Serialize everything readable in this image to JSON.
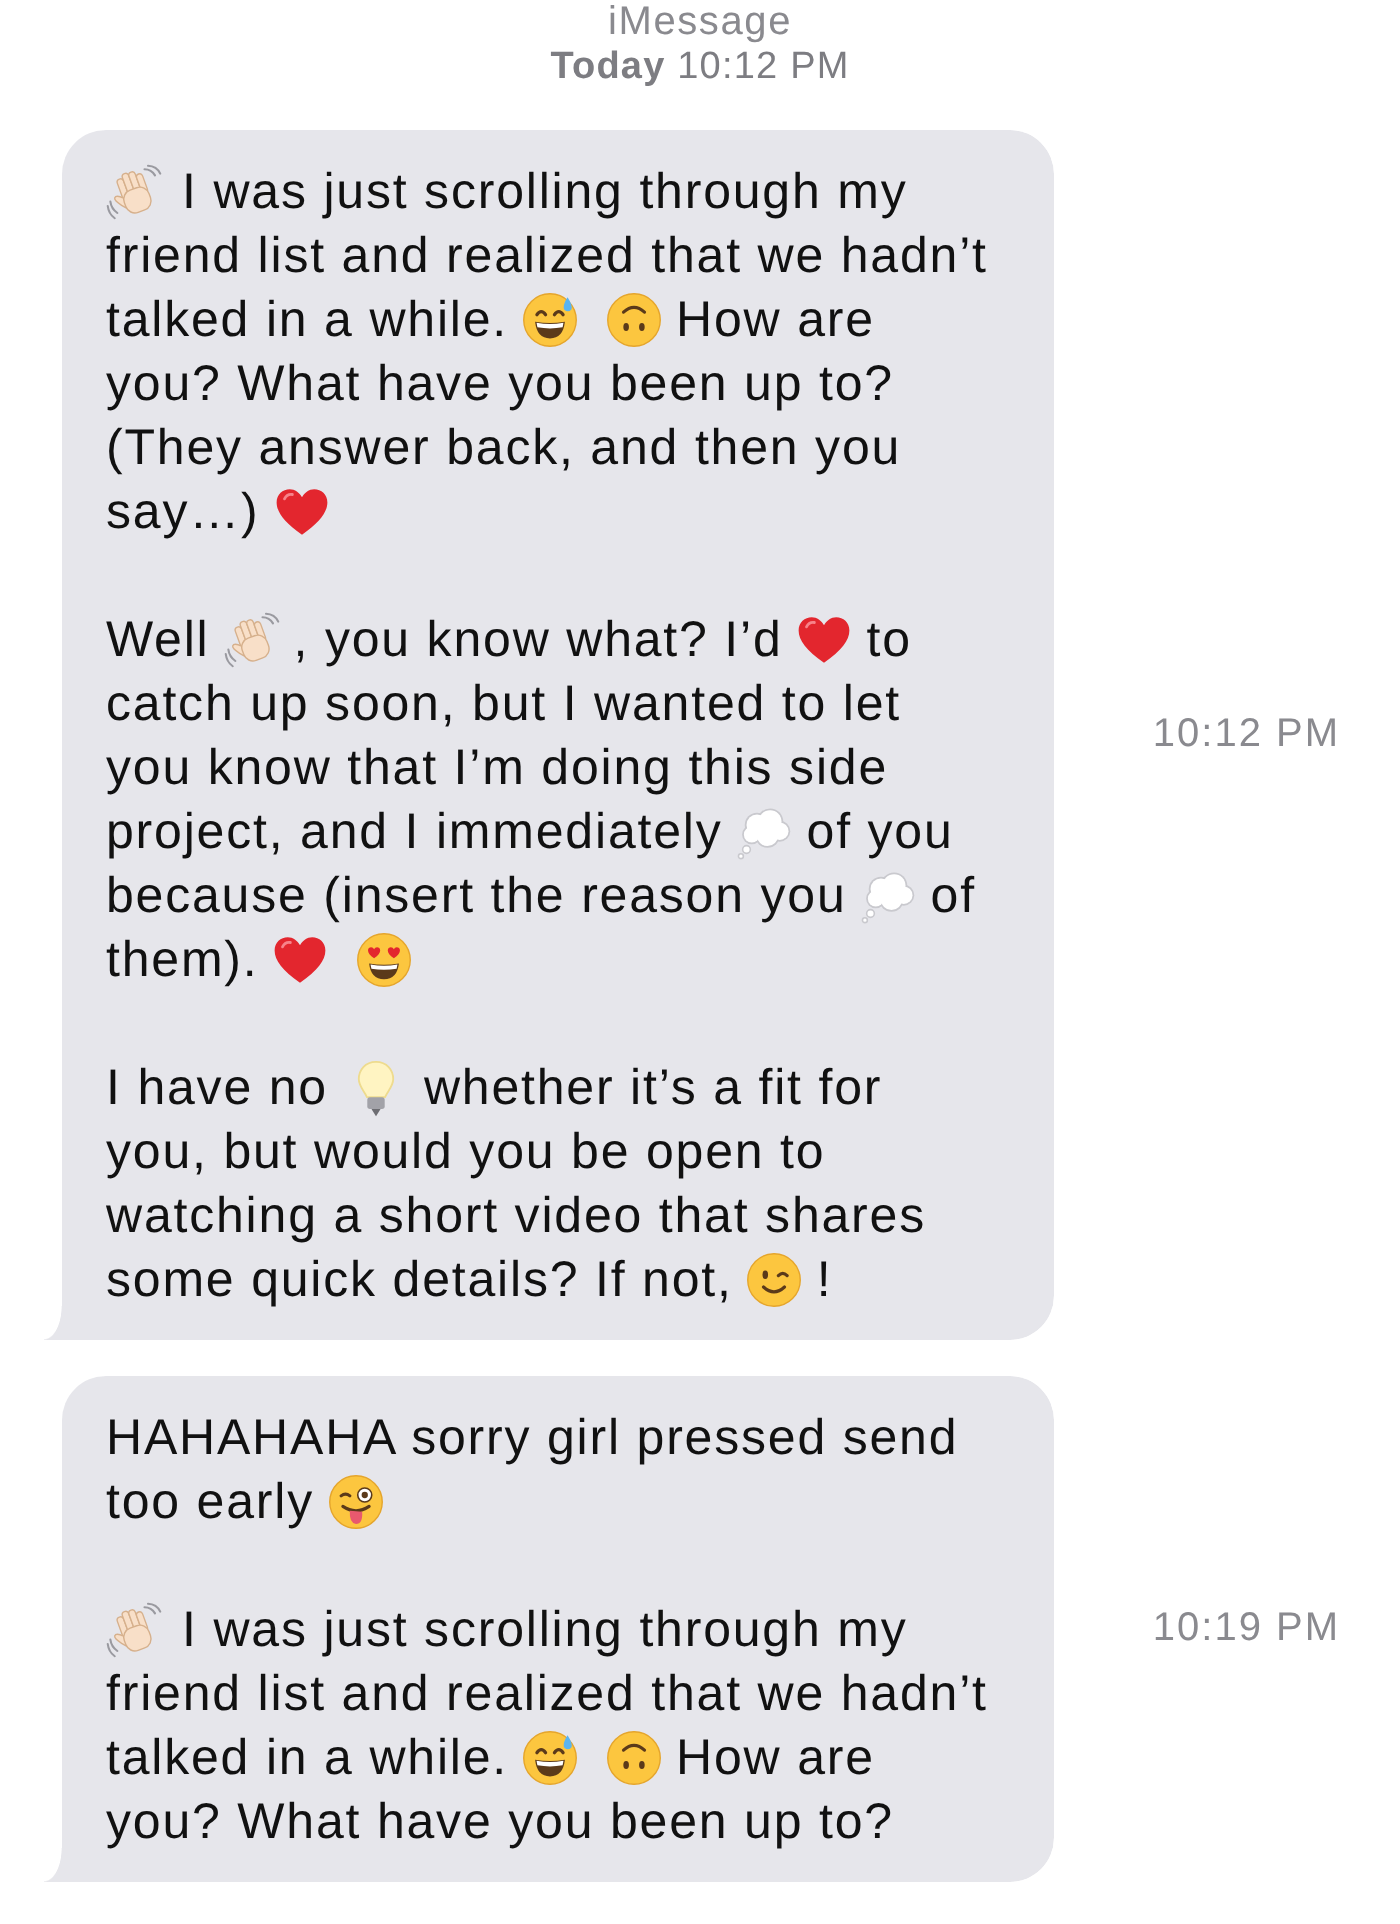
{
  "header": {
    "service": "iMessage",
    "timestamp": "**Today** 10:12 PM"
  },
  "messages": [
    {
      "time": "10:12 PM",
      "paragraphs": [
        [
          [
            {
              "kind": "wave"
            },
            {
              "kind": "text",
              "text": "I was just scrolling through my"
            }
          ],
          [
            {
              "kind": "text",
              "text": "friend list and realized that we hadn’t"
            }
          ],
          [
            {
              "kind": "text",
              "text": "talked in a while."
            },
            {
              "kind": "sweat"
            },
            {
              "kind": "upsidedown"
            },
            {
              "kind": "text",
              "text": "How are"
            }
          ],
          [
            {
              "kind": "text",
              "text": "you? What have you been up to?"
            }
          ],
          [
            {
              "kind": "text",
              "text": "(They answer back, and then you"
            }
          ],
          [
            {
              "kind": "text",
              "text": "say…)"
            },
            {
              "kind": "heart"
            }
          ]
        ],
        [
          [
            {
              "kind": "text",
              "text": "Well"
            },
            {
              "kind": "wave"
            },
            {
              "kind": "text",
              "text": ", you know what? I’d"
            },
            {
              "kind": "heart"
            },
            {
              "kind": "text",
              "text": "to"
            }
          ],
          [
            {
              "kind": "text",
              "text": "catch up soon, but I wanted to let"
            }
          ],
          [
            {
              "kind": "text",
              "text": "you know that I’m doing this side"
            }
          ],
          [
            {
              "kind": "text",
              "text": "project, and I immediately"
            },
            {
              "kind": "thought"
            },
            {
              "kind": "text",
              "text": "of you"
            }
          ],
          [
            {
              "kind": "text",
              "text": "because (insert the reason you"
            },
            {
              "kind": "thought"
            },
            {
              "kind": "text",
              "text": "of"
            }
          ],
          [
            {
              "kind": "text",
              "text": "them)."
            },
            {
              "kind": "heart"
            },
            {
              "kind": "hearteyes"
            }
          ]
        ],
        [
          [
            {
              "kind": "text",
              "text": "I have no"
            },
            {
              "kind": "bulb"
            },
            {
              "kind": "text",
              "text": "whether it’s a fit for"
            }
          ],
          [
            {
              "kind": "text",
              "text": "you, but would you be open to"
            }
          ],
          [
            {
              "kind": "text",
              "text": "watching a short video that shares"
            }
          ],
          [
            {
              "kind": "text",
              "text": "some quick details? If not,"
            },
            {
              "kind": "wink"
            },
            {
              "kind": "text",
              "text": "!"
            }
          ]
        ]
      ]
    },
    {
      "time": "10:19 PM",
      "paragraphs": [
        [
          [
            {
              "kind": "text",
              "text": "HAHAHAHA sorry girl pressed send"
            }
          ],
          [
            {
              "kind": "text",
              "text": "too early"
            },
            {
              "kind": "tongue"
            }
          ]
        ],
        [
          [
            {
              "kind": "wave"
            },
            {
              "kind": "text",
              "text": "I was just scrolling through my"
            }
          ],
          [
            {
              "kind": "text",
              "text": "friend list and realized that we hadn’t"
            }
          ],
          [
            {
              "kind": "text",
              "text": "talked in a while."
            },
            {
              "kind": "sweat"
            },
            {
              "kind": "upsidedown"
            },
            {
              "kind": "text",
              "text": "How are"
            }
          ],
          [
            {
              "kind": "text",
              "text": "you? What have you been up to?"
            }
          ]
        ]
      ]
    }
  ]
}
